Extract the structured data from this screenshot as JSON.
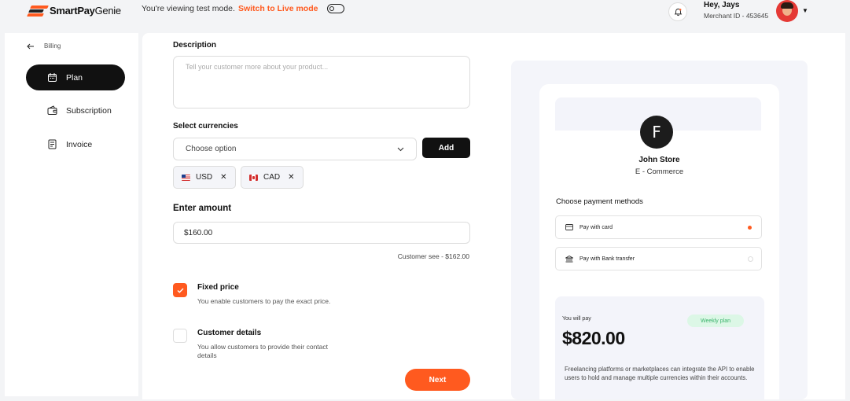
{
  "brand": {
    "name_bold": "SmartPay",
    "name_light": "Genie"
  },
  "header": {
    "testmode_text": "You're viewing test mode.",
    "live_link": "Switch to Live mode",
    "greeting": "Hey, Jays",
    "merchant_id": "Merchant ID - 453645"
  },
  "sidebar": {
    "back_label": "Billing",
    "items": [
      {
        "label": "Plan",
        "active": true
      },
      {
        "label": "Subscription",
        "active": false
      },
      {
        "label": "Invoice",
        "active": false
      }
    ]
  },
  "form": {
    "description_label": "Description",
    "description_placeholder": "Tell your customer more about your product...",
    "currencies_label": "Select currencies",
    "currency_select": "Choose option",
    "add_label": "Add",
    "chips": [
      "USD",
      "CAD"
    ],
    "amount_label": "Enter amount",
    "amount_value": "$160.00",
    "customer_see": "Customer see - $162.00",
    "options": [
      {
        "title": "Fixed price",
        "desc": "You enable customers to pay the exact price.",
        "checked": true
      },
      {
        "title": "Customer details",
        "desc": "You allow customers to provide their contact details",
        "checked": false
      }
    ],
    "next_label": "Next"
  },
  "preview": {
    "store_initial": "F",
    "store_name": "John Store",
    "store_type": "E - Commerce",
    "choose_label": "Choose payment methods",
    "methods": [
      {
        "label": "Pay with card",
        "selected": true
      },
      {
        "label": "Pay with Bank transfer",
        "selected": false
      }
    ],
    "you_will_pay": "You will pay",
    "plan_badge": "Weekly plan",
    "price": "$820.00",
    "info": "Freelancing platforms or marketplaces can integrate the API to enable users to hold and manage multiple currencies within their accounts."
  },
  "colors": {
    "accent": "#ff5a1f",
    "dark": "#111111",
    "badge_green": "#3ab36b"
  }
}
